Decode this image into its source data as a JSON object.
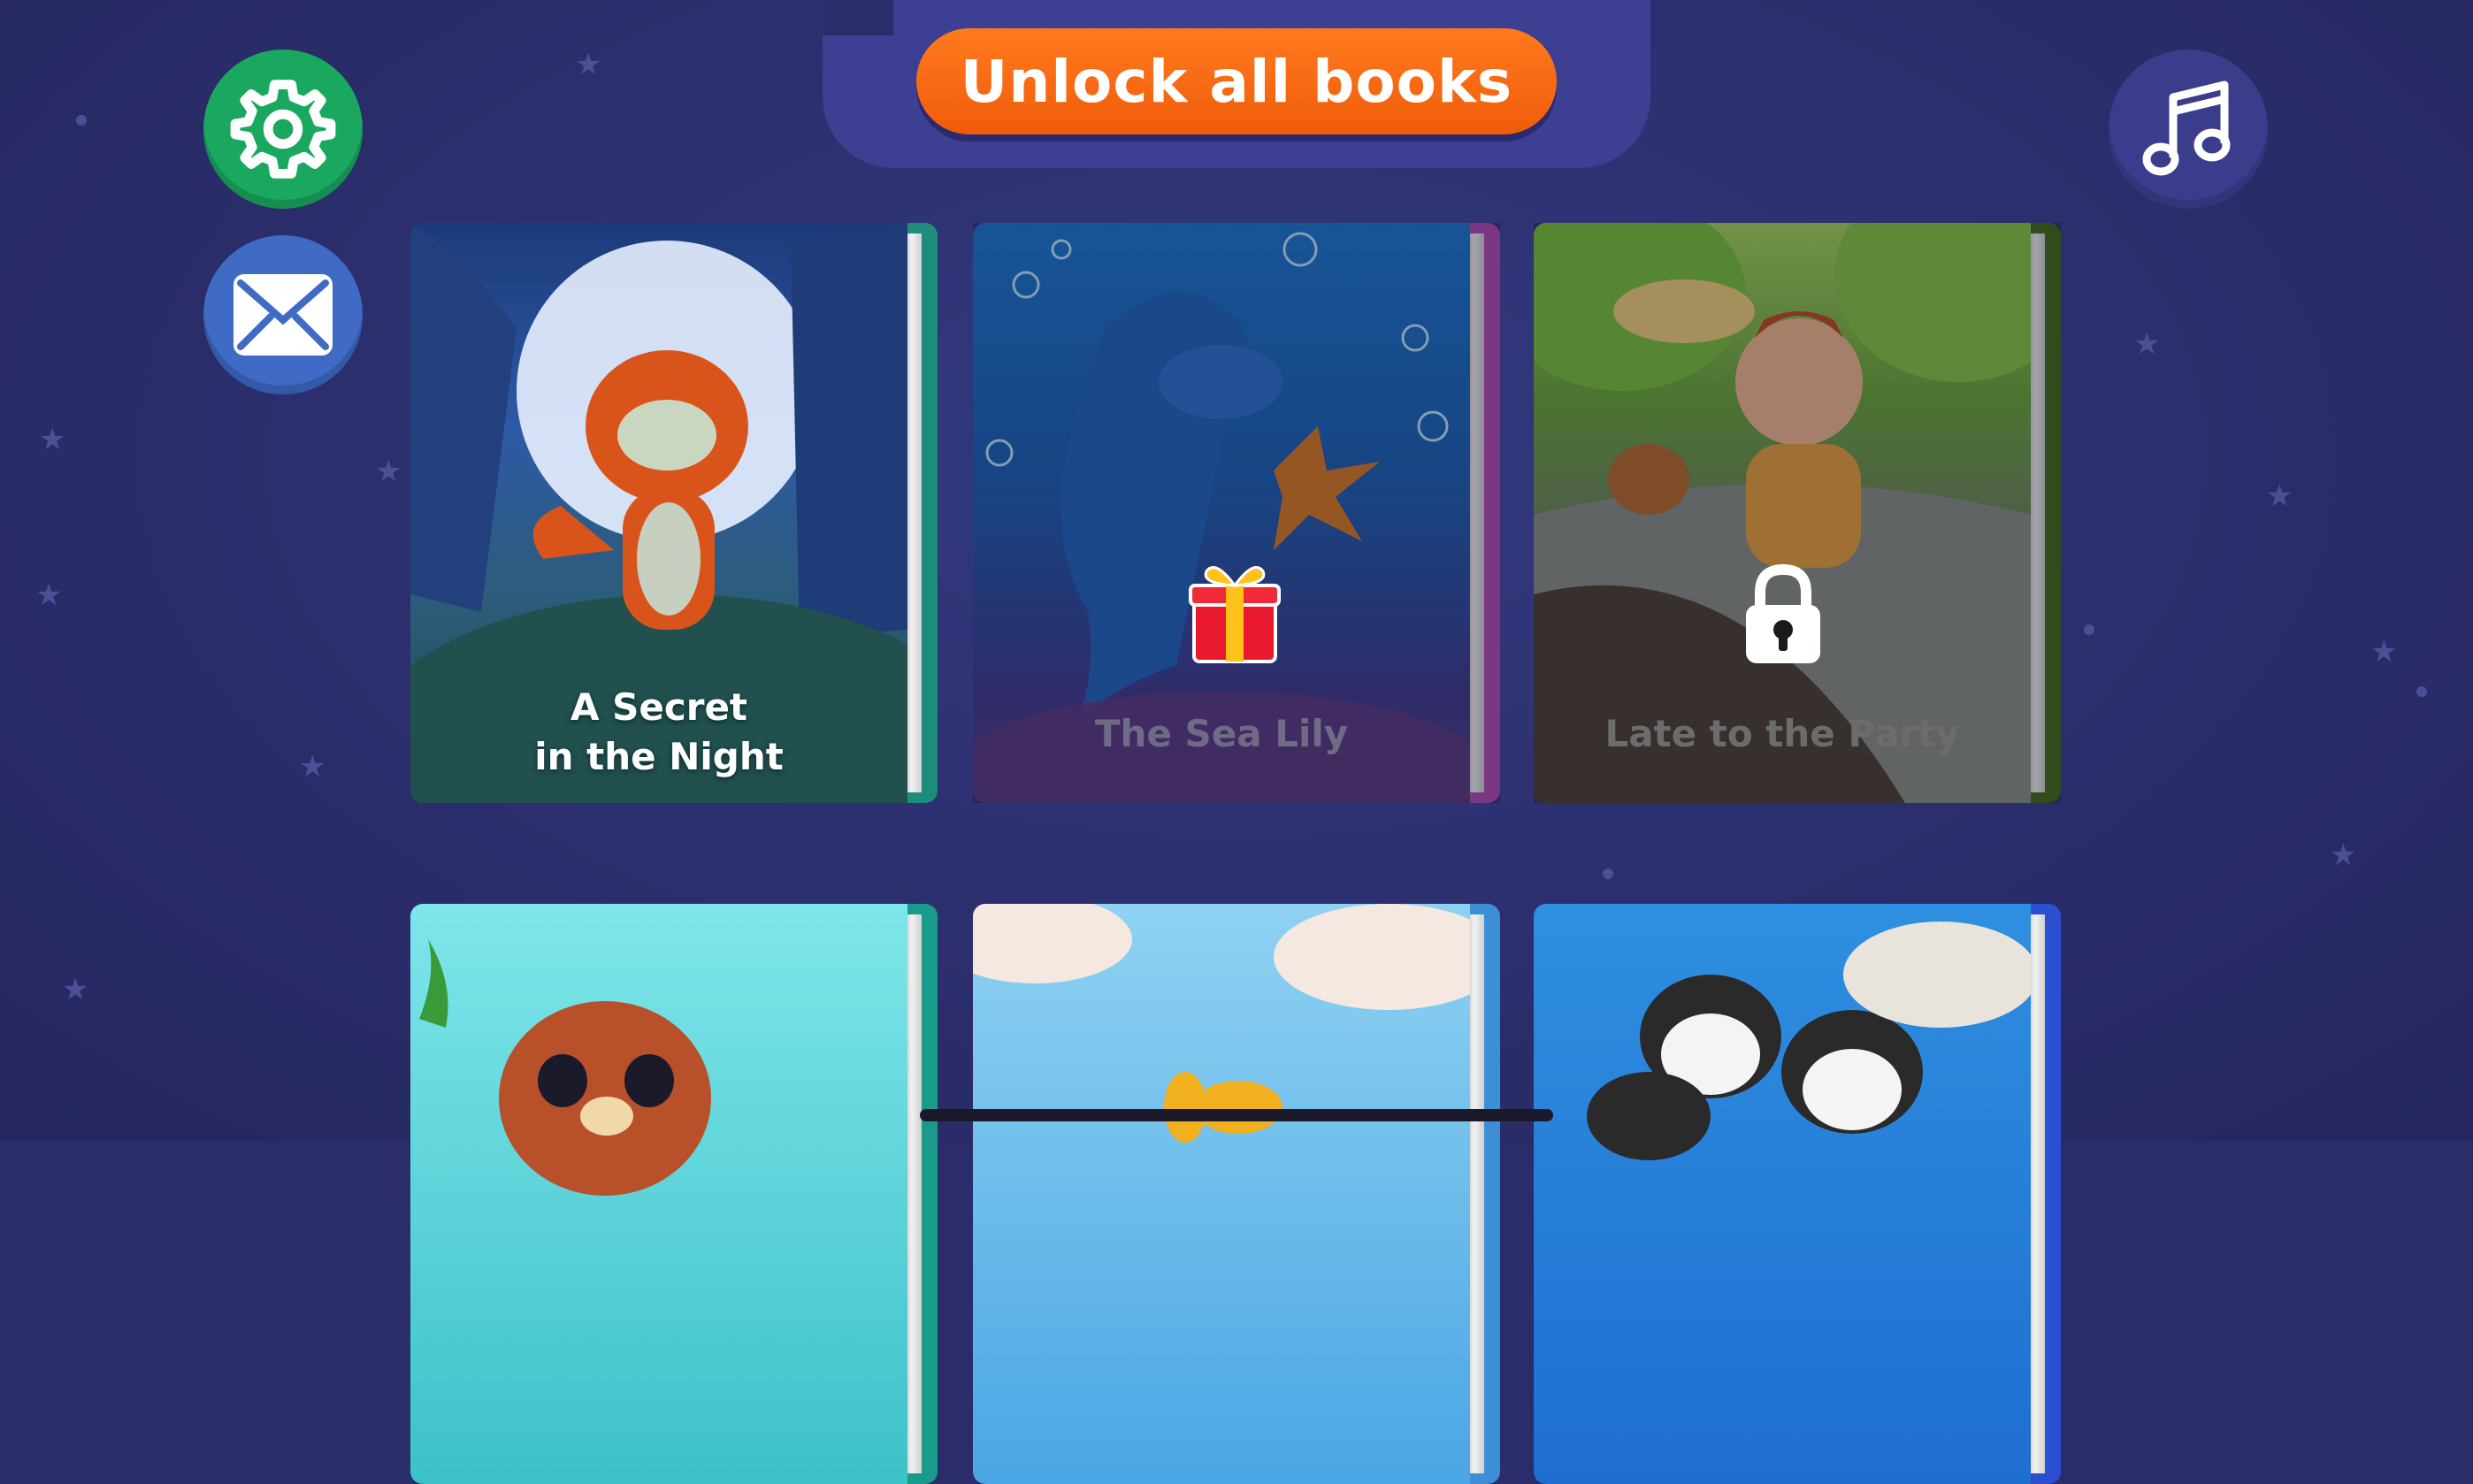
{
  "header": {
    "unlock_label": "Unlock all books"
  },
  "icons": {
    "settings": "gear-icon",
    "mail": "envelope-icon",
    "music": "music-note-icon",
    "gift": "gift-icon",
    "lock": "lock-icon"
  },
  "books": [
    {
      "title_line1": "A Secret",
      "title_line2": "in the Night",
      "status": "unlocked"
    },
    {
      "title": "The Sea Lily",
      "status": "gift"
    },
    {
      "title": "Late to the Party",
      "status": "locked"
    },
    {
      "title": "",
      "status": "unlocked"
    },
    {
      "title": "",
      "status": "unlocked"
    },
    {
      "title": "",
      "status": "unlocked"
    }
  ],
  "colors": {
    "background": "#2b2d6b",
    "accent_orange": "#f26a10",
    "settings_green": "#1aa860",
    "mail_blue": "#3f6bc4"
  }
}
